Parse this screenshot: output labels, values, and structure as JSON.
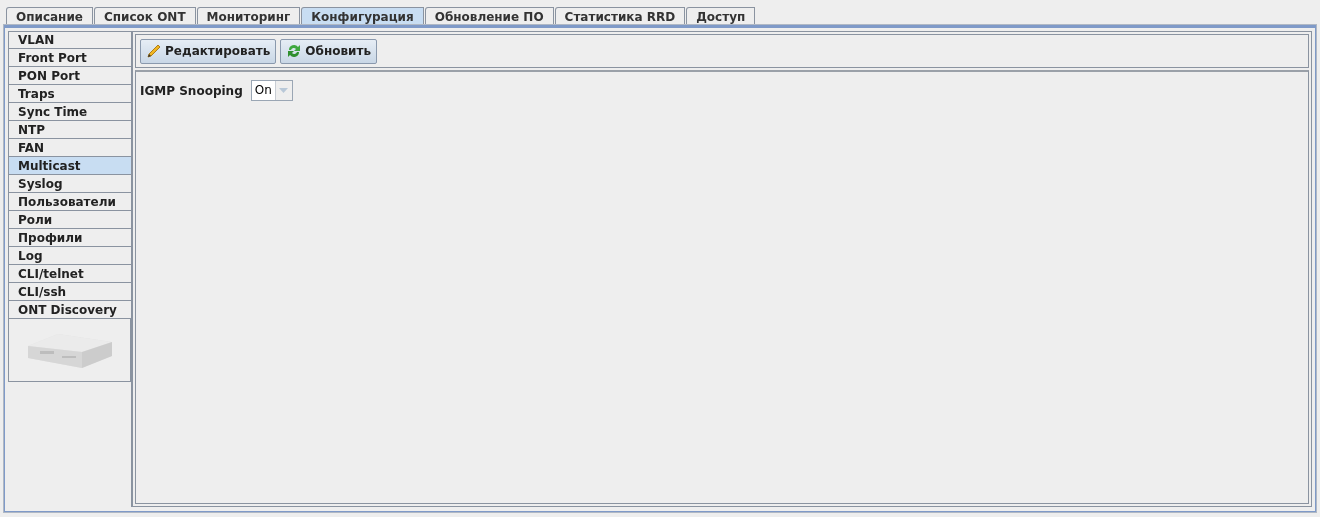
{
  "tabs": [
    {
      "label": "Описание",
      "selected": false
    },
    {
      "label": "Список ONT",
      "selected": false
    },
    {
      "label": "Мониторинг",
      "selected": false
    },
    {
      "label": "Конфигурация",
      "selected": true
    },
    {
      "label": "Обновление ПО",
      "selected": false
    },
    {
      "label": "Статистика RRD",
      "selected": false
    },
    {
      "label": "Доступ",
      "selected": false
    }
  ],
  "sidebar": {
    "items": [
      {
        "label": "VLAN",
        "selected": false
      },
      {
        "label": "Front Port",
        "selected": false
      },
      {
        "label": "PON Port",
        "selected": false
      },
      {
        "label": "Traps",
        "selected": false
      },
      {
        "label": "Sync Time",
        "selected": false
      },
      {
        "label": "NTP",
        "selected": false
      },
      {
        "label": "FAN",
        "selected": false
      },
      {
        "label": "Multicast",
        "selected": true
      },
      {
        "label": "Syslog",
        "selected": false
      },
      {
        "label": "Пользователи",
        "selected": false
      },
      {
        "label": "Роли",
        "selected": false
      },
      {
        "label": "Профили",
        "selected": false
      },
      {
        "label": "Log",
        "selected": false
      },
      {
        "label": "CLI/telnet",
        "selected": false
      },
      {
        "label": "CLI/ssh",
        "selected": false
      },
      {
        "label": "ONT Discovery",
        "selected": false
      }
    ]
  },
  "toolbar": [
    {
      "kind": "edit",
      "label": "Редактировать"
    },
    {
      "kind": "refresh",
      "label": "Обновить"
    }
  ],
  "form": {
    "label": "IGMP Snooping",
    "value": "On"
  }
}
